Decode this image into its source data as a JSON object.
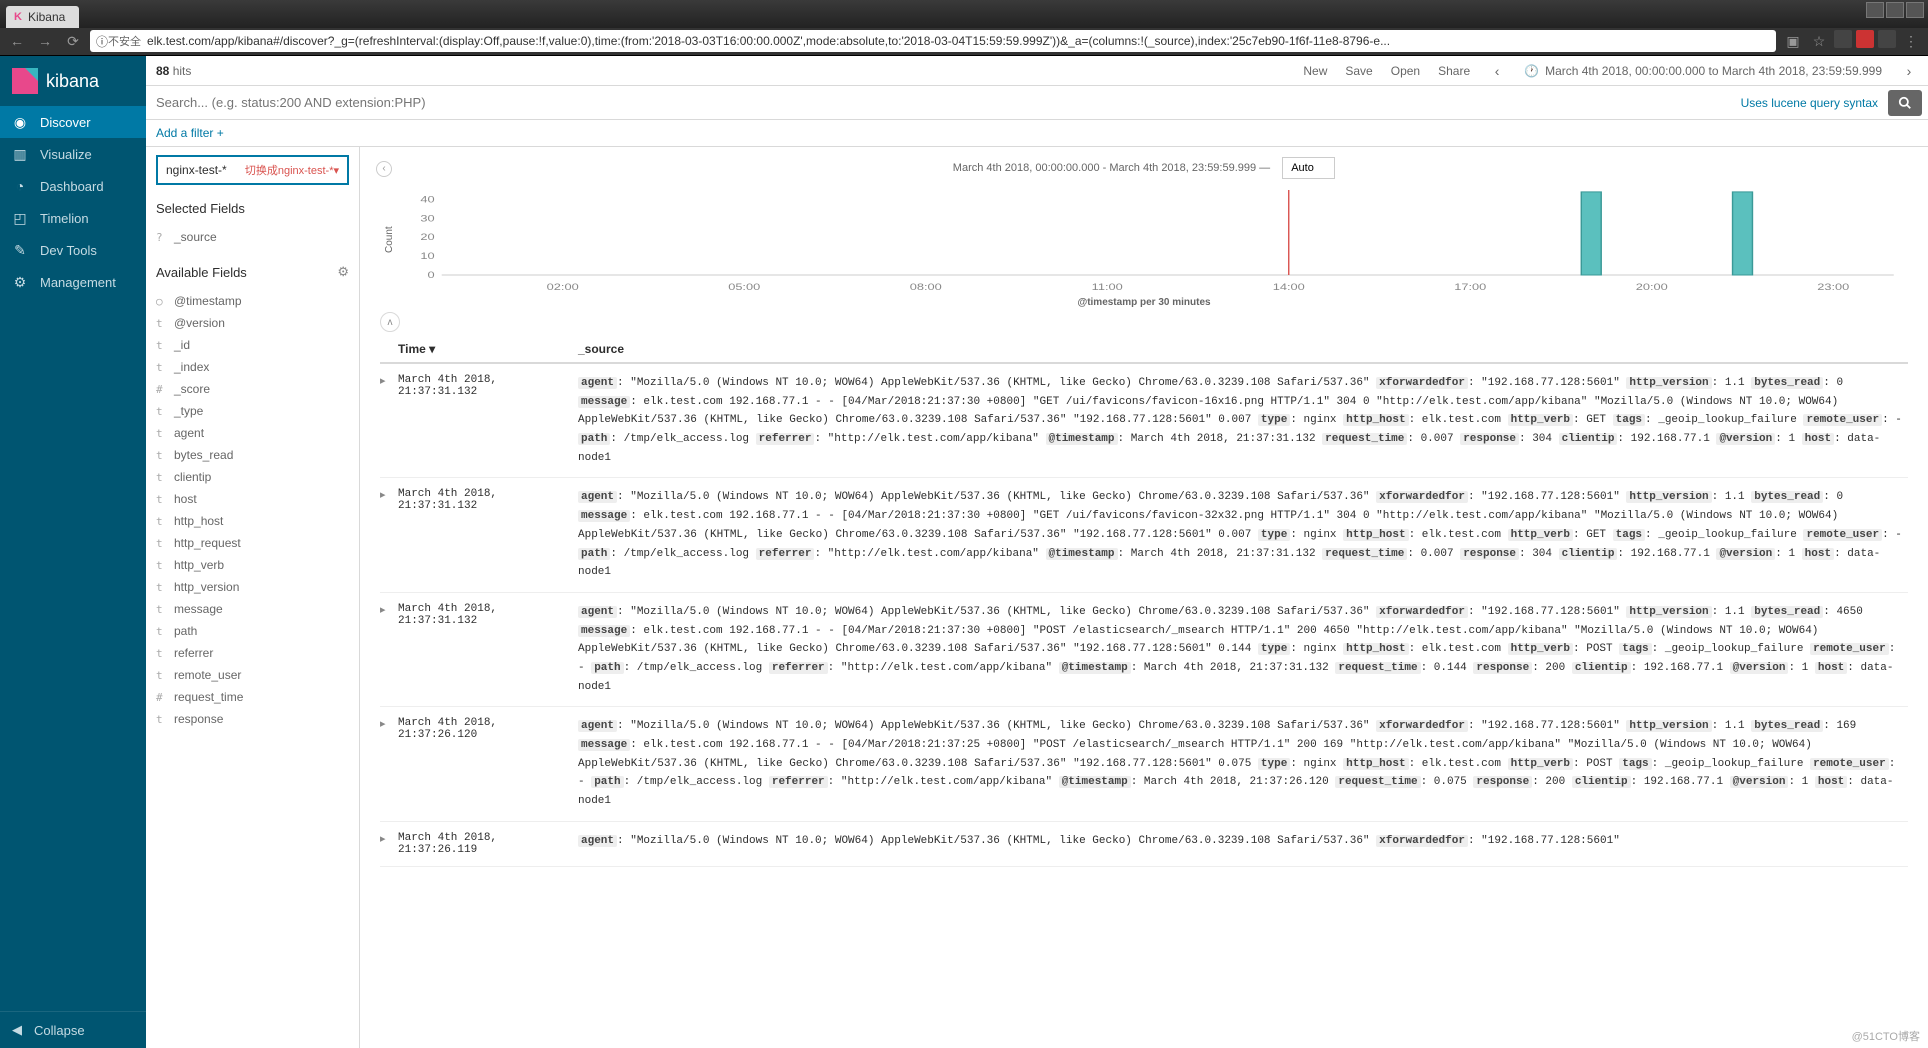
{
  "browser": {
    "tab_title": "Kibana",
    "insecure_label": "不安全",
    "url": "elk.test.com/app/kibana#/discover?_g=(refreshInterval:(display:Off,pause:!f,value:0),time:(from:'2018-03-03T16:00:00.000Z',mode:absolute,to:'2018-03-04T15:59:59.999Z'))&_a=(columns:!(_source),index:'25c7eb90-1f6f-11e8-8796-e..."
  },
  "logo": "kibana",
  "nav": [
    {
      "label": "Discover",
      "icon": "◉"
    },
    {
      "label": "Visualize",
      "icon": "▥"
    },
    {
      "label": "Dashboard",
      "icon": "◔"
    },
    {
      "label": "Timelion",
      "icon": "◰"
    },
    {
      "label": "Dev Tools",
      "icon": "✎"
    },
    {
      "label": "Management",
      "icon": "⚙"
    }
  ],
  "collapse_label": "Collapse",
  "hits": {
    "count": "88",
    "label": "hits"
  },
  "top_links": {
    "new": "New",
    "save": "Save",
    "open": "Open",
    "share": "Share"
  },
  "time_range_picker": "March 4th 2018, 00:00:00.000 to March 4th 2018, 23:59:59.999",
  "search_placeholder": "Search... (e.g. status:200 AND extension:PHP)",
  "lucene_hint": "Uses lucene query syntax",
  "add_filter": "Add a filter +",
  "index_pattern": "nginx-test-*",
  "index_annotation": "切换成nginx-test-*▾",
  "selected_fields_label": "Selected Fields",
  "selected_fields": [
    {
      "type": "?",
      "name": "_source"
    }
  ],
  "available_fields_label": "Available Fields",
  "available_fields": [
    {
      "type": "○",
      "name": "@timestamp"
    },
    {
      "type": "t",
      "name": "@version"
    },
    {
      "type": "t",
      "name": "_id"
    },
    {
      "type": "t",
      "name": "_index"
    },
    {
      "type": "#",
      "name": "_score"
    },
    {
      "type": "t",
      "name": "_type"
    },
    {
      "type": "t",
      "name": "agent"
    },
    {
      "type": "t",
      "name": "bytes_read"
    },
    {
      "type": "t",
      "name": "clientip"
    },
    {
      "type": "t",
      "name": "host"
    },
    {
      "type": "t",
      "name": "http_host"
    },
    {
      "type": "t",
      "name": "http_request"
    },
    {
      "type": "t",
      "name": "http_verb"
    },
    {
      "type": "t",
      "name": "http_version"
    },
    {
      "type": "t",
      "name": "message"
    },
    {
      "type": "t",
      "name": "path"
    },
    {
      "type": "t",
      "name": "referrer"
    },
    {
      "type": "t",
      "name": "remote_user"
    },
    {
      "type": "#",
      "name": "request_time"
    },
    {
      "type": "t",
      "name": "response"
    }
  ],
  "chart_title": "March 4th 2018, 00:00:00.000 - March 4th 2018, 23:59:59.999 —",
  "interval": "Auto",
  "chart_data": {
    "type": "bar",
    "ylabel": "Count",
    "xlabel": "@timestamp per 30 minutes",
    "y_ticks": [
      0,
      10,
      20,
      30,
      40
    ],
    "x_ticks": [
      "02:00",
      "05:00",
      "08:00",
      "11:00",
      "14:00",
      "17:00",
      "20:00",
      "23:00"
    ],
    "x_range_hours": [
      0,
      24
    ],
    "series": [
      {
        "x_hour": 14.0,
        "value": 0,
        "marker": "line"
      },
      {
        "x_hour": 19.0,
        "value": 44
      },
      {
        "x_hour": 21.5,
        "value": 44
      }
    ],
    "ylim": [
      0,
      45
    ]
  },
  "table": {
    "col_time": "Time ▾",
    "col_source": "_source",
    "rows": [
      {
        "time": "March 4th 2018, 21:37:31.132",
        "source": [
          {
            "k": "agent",
            "v": "\"Mozilla/5.0 (Windows NT 10.0; WOW64) AppleWebKit/537.36 (KHTML, like Gecko) Chrome/63.0.3239.108 Safari/537.36\""
          },
          {
            "k": "xforwardedfor",
            "v": "\"192.168.77.128:5601\""
          },
          {
            "k": "http_version",
            "v": "1.1"
          },
          {
            "k": "bytes_read",
            "v": "0"
          },
          {
            "k": "message",
            "v": "elk.test.com 192.168.77.1 - - [04/Mar/2018:21:37:30 +0800] \"GET /ui/favicons/favicon-16x16.png HTTP/1.1\" 304 0 \"http://elk.test.com/app/kibana\" \"Mozilla/5.0 (Windows NT 10.0; WOW64) AppleWebKit/537.36 (KHTML, like Gecko) Chrome/63.0.3239.108 Safari/537.36\" \"192.168.77.128:5601\" 0.007"
          },
          {
            "k": "type",
            "v": "nginx"
          },
          {
            "k": "http_host",
            "v": "elk.test.com"
          },
          {
            "k": "http_verb",
            "v": "GET"
          },
          {
            "k": "tags",
            "v": "_geoip_lookup_failure"
          },
          {
            "k": "remote_user",
            "v": "-"
          },
          {
            "k": "path",
            "v": "/tmp/elk_access.log"
          },
          {
            "k": "referrer",
            "v": "\"http://elk.test.com/app/kibana\""
          },
          {
            "k": "@timestamp",
            "v": "March 4th 2018, 21:37:31.132"
          },
          {
            "k": "request_time",
            "v": "0.007"
          },
          {
            "k": "response",
            "v": "304"
          },
          {
            "k": "clientip",
            "v": "192.168.77.1"
          },
          {
            "k": "@version",
            "v": "1"
          },
          {
            "k": "host",
            "v": "data-node1"
          }
        ]
      },
      {
        "time": "March 4th 2018, 21:37:31.132",
        "source": [
          {
            "k": "agent",
            "v": "\"Mozilla/5.0 (Windows NT 10.0; WOW64) AppleWebKit/537.36 (KHTML, like Gecko) Chrome/63.0.3239.108 Safari/537.36\""
          },
          {
            "k": "xforwardedfor",
            "v": "\"192.168.77.128:5601\""
          },
          {
            "k": "http_version",
            "v": "1.1"
          },
          {
            "k": "bytes_read",
            "v": "0"
          },
          {
            "k": "message",
            "v": "elk.test.com 192.168.77.1 - - [04/Mar/2018:21:37:30 +0800] \"GET /ui/favicons/favicon-32x32.png HTTP/1.1\" 304 0 \"http://elk.test.com/app/kibana\" \"Mozilla/5.0 (Windows NT 10.0; WOW64) AppleWebKit/537.36 (KHTML, like Gecko) Chrome/63.0.3239.108 Safari/537.36\" \"192.168.77.128:5601\" 0.007"
          },
          {
            "k": "type",
            "v": "nginx"
          },
          {
            "k": "http_host",
            "v": "elk.test.com"
          },
          {
            "k": "http_verb",
            "v": "GET"
          },
          {
            "k": "tags",
            "v": "_geoip_lookup_failure"
          },
          {
            "k": "remote_user",
            "v": "-"
          },
          {
            "k": "path",
            "v": "/tmp/elk_access.log"
          },
          {
            "k": "referrer",
            "v": "\"http://elk.test.com/app/kibana\""
          },
          {
            "k": "@timestamp",
            "v": "March 4th 2018, 21:37:31.132"
          },
          {
            "k": "request_time",
            "v": "0.007"
          },
          {
            "k": "response",
            "v": "304"
          },
          {
            "k": "clientip",
            "v": "192.168.77.1"
          },
          {
            "k": "@version",
            "v": "1"
          },
          {
            "k": "host",
            "v": "data-node1"
          }
        ]
      },
      {
        "time": "March 4th 2018, 21:37:31.132",
        "source": [
          {
            "k": "agent",
            "v": "\"Mozilla/5.0 (Windows NT 10.0; WOW64) AppleWebKit/537.36 (KHTML, like Gecko) Chrome/63.0.3239.108 Safari/537.36\""
          },
          {
            "k": "xforwardedfor",
            "v": "\"192.168.77.128:5601\""
          },
          {
            "k": "http_version",
            "v": "1.1"
          },
          {
            "k": "bytes_read",
            "v": "4650"
          },
          {
            "k": "message",
            "v": "elk.test.com 192.168.77.1 - - [04/Mar/2018:21:37:30 +0800] \"POST /elasticsearch/_msearch HTTP/1.1\" 200 4650 \"http://elk.test.com/app/kibana\" \"Mozilla/5.0 (Windows NT 10.0; WOW64) AppleWebKit/537.36 (KHTML, like Gecko) Chrome/63.0.3239.108 Safari/537.36\" \"192.168.77.128:5601\" 0.144"
          },
          {
            "k": "type",
            "v": "nginx"
          },
          {
            "k": "http_host",
            "v": "elk.test.com"
          },
          {
            "k": "http_verb",
            "v": "POST"
          },
          {
            "k": "tags",
            "v": "_geoip_lookup_failure"
          },
          {
            "k": "remote_user",
            "v": "-"
          },
          {
            "k": "path",
            "v": "/tmp/elk_access.log"
          },
          {
            "k": "referrer",
            "v": "\"http://elk.test.com/app/kibana\""
          },
          {
            "k": "@timestamp",
            "v": "March 4th 2018, 21:37:31.132"
          },
          {
            "k": "request_time",
            "v": "0.144"
          },
          {
            "k": "response",
            "v": "200"
          },
          {
            "k": "clientip",
            "v": "192.168.77.1"
          },
          {
            "k": "@version",
            "v": "1"
          },
          {
            "k": "host",
            "v": "data-node1"
          }
        ]
      },
      {
        "time": "March 4th 2018, 21:37:26.120",
        "source": [
          {
            "k": "agent",
            "v": "\"Mozilla/5.0 (Windows NT 10.0; WOW64) AppleWebKit/537.36 (KHTML, like Gecko) Chrome/63.0.3239.108 Safari/537.36\""
          },
          {
            "k": "xforwardedfor",
            "v": "\"192.168.77.128:5601\""
          },
          {
            "k": "http_version",
            "v": "1.1"
          },
          {
            "k": "bytes_read",
            "v": "169"
          },
          {
            "k": "message",
            "v": "elk.test.com 192.168.77.1 - - [04/Mar/2018:21:37:25 +0800] \"POST /elasticsearch/_msearch HTTP/1.1\" 200 169 \"http://elk.test.com/app/kibana\" \"Mozilla/5.0 (Windows NT 10.0; WOW64) AppleWebKit/537.36 (KHTML, like Gecko) Chrome/63.0.3239.108 Safari/537.36\" \"192.168.77.128:5601\" 0.075"
          },
          {
            "k": "type",
            "v": "nginx"
          },
          {
            "k": "http_host",
            "v": "elk.test.com"
          },
          {
            "k": "http_verb",
            "v": "POST"
          },
          {
            "k": "tags",
            "v": "_geoip_lookup_failure"
          },
          {
            "k": "remote_user",
            "v": "-"
          },
          {
            "k": "path",
            "v": "/tmp/elk_access.log"
          },
          {
            "k": "referrer",
            "v": "\"http://elk.test.com/app/kibana\""
          },
          {
            "k": "@timestamp",
            "v": "March 4th 2018, 21:37:26.120"
          },
          {
            "k": "request_time",
            "v": "0.075"
          },
          {
            "k": "response",
            "v": "200"
          },
          {
            "k": "clientip",
            "v": "192.168.77.1"
          },
          {
            "k": "@version",
            "v": "1"
          },
          {
            "k": "host",
            "v": "data-node1"
          }
        ]
      },
      {
        "time": "March 4th 2018, 21:37:26.119",
        "source": [
          {
            "k": "agent",
            "v": "\"Mozilla/5.0 (Windows NT 10.0; WOW64) AppleWebKit/537.36 (KHTML, like Gecko) Chrome/63.0.3239.108 Safari/537.36\""
          },
          {
            "k": "xforwardedfor",
            "v": "\"192.168.77.128:5601\""
          }
        ]
      }
    ]
  },
  "watermark": "@51CTO博客"
}
